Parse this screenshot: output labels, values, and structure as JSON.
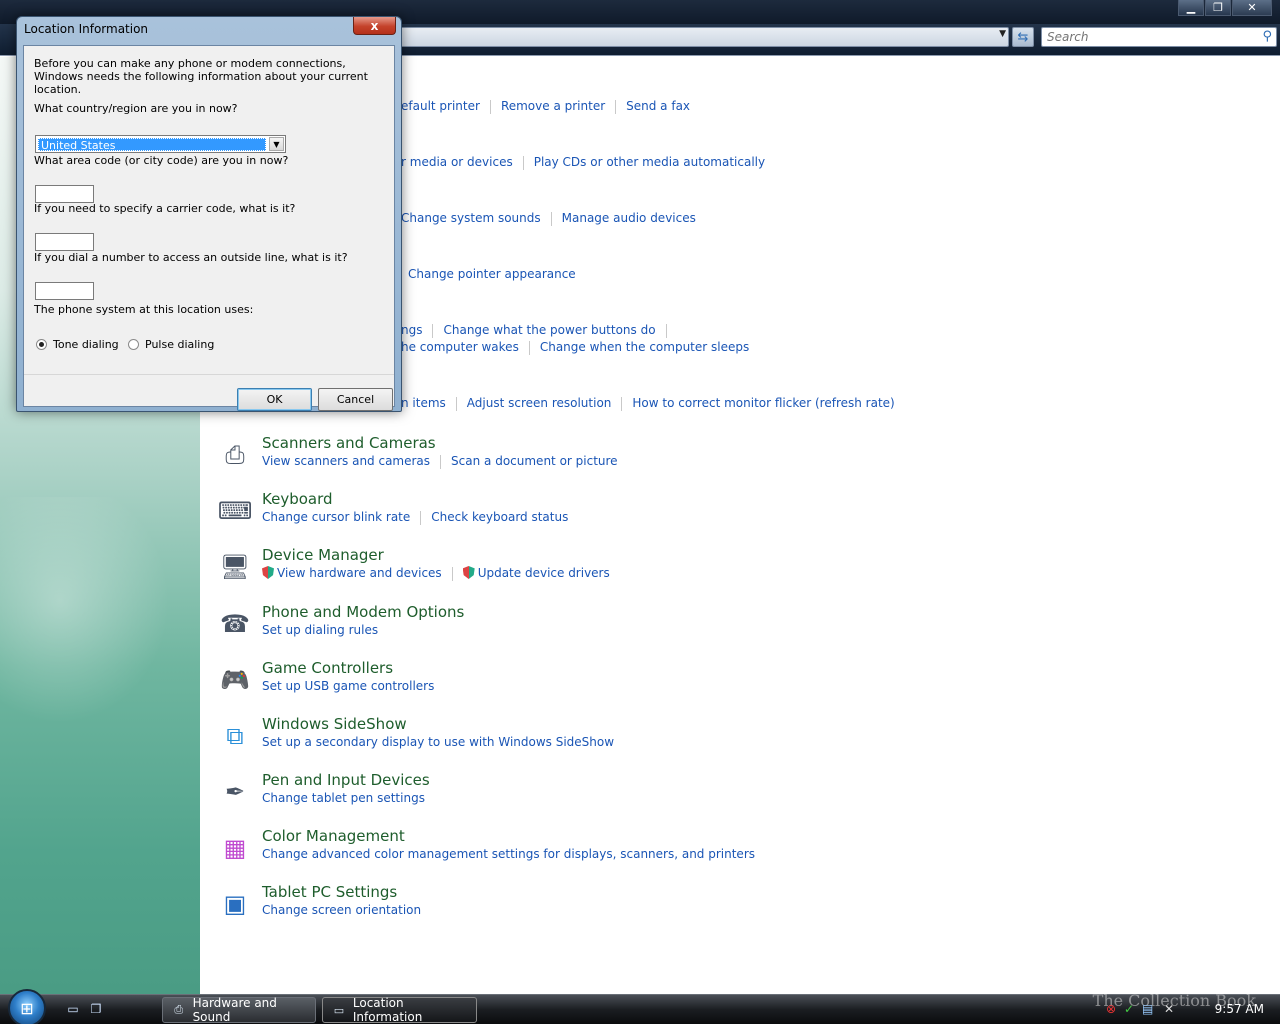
{
  "window": {
    "search_placeholder": "Search",
    "buttons": {
      "minimize": "▁",
      "maximize": "❐",
      "close": "✕"
    }
  },
  "content_rows": {
    "printers": [
      "efault printer",
      "Remove a printer",
      "Send a fax"
    ],
    "autoplay": [
      "r media or devices",
      "Play CDs or other media automatically"
    ],
    "sound": [
      "Change system sounds",
      "Manage audio devices"
    ],
    "mouse": [
      "Change pointer appearance"
    ],
    "power1": [
      "ngs",
      "Change what the power buttons do"
    ],
    "power2": [
      "he computer wakes",
      "Change when the computer sleeps"
    ],
    "display": [
      "n items",
      "Adjust screen resolution",
      "How to correct monitor flicker (refresh rate)"
    ]
  },
  "categories": [
    {
      "title": "Scanners and Cameras",
      "icon": "scanner-icon",
      "links": [
        "View scanners and cameras",
        "Scan a document or picture"
      ]
    },
    {
      "title": "Keyboard",
      "icon": "keyboard-icon",
      "links": [
        "Change cursor blink rate",
        "Check keyboard status"
      ]
    },
    {
      "title": "Device Manager",
      "icon": "device-manager-icon",
      "links": [
        "View hardware and devices",
        "Update device drivers"
      ]
    },
    {
      "title": "Phone and Modem Options",
      "icon": "phone-icon",
      "links": [
        "Set up dialing rules"
      ]
    },
    {
      "title": "Game Controllers",
      "icon": "gamepad-icon",
      "links": [
        "Set up USB game controllers"
      ]
    },
    {
      "title": "Windows SideShow",
      "icon": "sideshow-icon",
      "links": [
        "Set up a secondary display to use with Windows SideShow"
      ]
    },
    {
      "title": "Pen and Input Devices",
      "icon": "pen-icon",
      "links": [
        "Change tablet pen settings"
      ]
    },
    {
      "title": "Color Management",
      "icon": "color-management-icon",
      "links": [
        "Change advanced color management settings for displays, scanners, and printers"
      ]
    },
    {
      "title": "Tablet PC Settings",
      "icon": "tablet-icon",
      "links": [
        "Change screen orientation"
      ]
    }
  ],
  "dialog": {
    "title": "Location Information",
    "close": "x",
    "intro": "Before you can make any phone or modem connections, Windows needs the following information about your current location.",
    "country_label": "What country/region are you in now?",
    "country_value": "United States",
    "area_label": "What area code (or city code) are you in now?",
    "area_value": "",
    "carrier_label": "If you need to specify a carrier code, what is it?",
    "carrier_value": "",
    "outside_label": "If you dial a number to access an outside line, what is it?",
    "outside_value": "",
    "phone_system_label": "The phone system at this location uses:",
    "radio_tone": "Tone dialing",
    "radio_pulse": "Pulse dialing",
    "selected_dialing": "tone",
    "ok": "OK",
    "cancel": "Cancel"
  },
  "taskbar": {
    "tasks": [
      {
        "label": "Hardware and Sound",
        "icon": "printer-icon",
        "active": false
      },
      {
        "label": "Location Information",
        "icon": "window-icon",
        "active": true
      }
    ],
    "clock": "9:57 AM",
    "watermark": "The Collection Book"
  }
}
